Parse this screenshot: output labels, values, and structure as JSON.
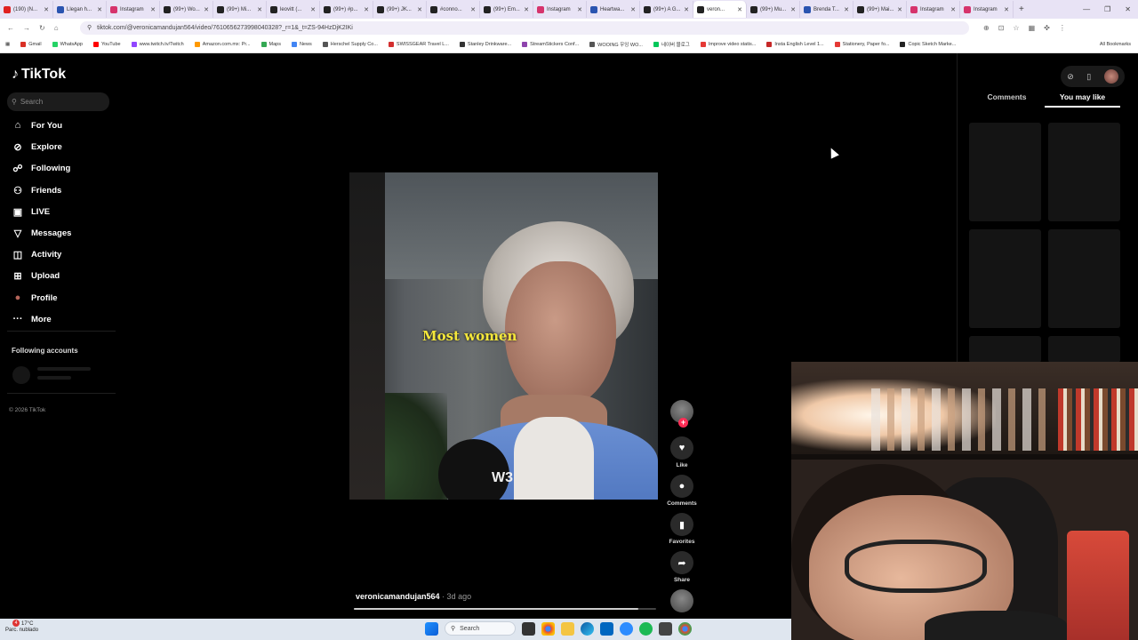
{
  "browser": {
    "tabs": [
      {
        "label": "(190) (N...",
        "color": "#e02020"
      },
      {
        "label": "Llegan h...",
        "color": "#2a54b0"
      },
      {
        "label": "Instagram",
        "color": "#d6336c"
      },
      {
        "label": "(99+) Wo...",
        "color": "#222222"
      },
      {
        "label": "(99+) Mi...",
        "color": "#222222"
      },
      {
        "label": "leovitt (...",
        "color": "#222222"
      },
      {
        "label": "(99+) #p...",
        "color": "#222222"
      },
      {
        "label": "(99+) JK...",
        "color": "#222222"
      },
      {
        "label": "#conno...",
        "color": "#222222"
      },
      {
        "label": "(99+) Em...",
        "color": "#222222"
      },
      {
        "label": "Instagram",
        "color": "#d6336c"
      },
      {
        "label": "Heartwa...",
        "color": "#2a54b0"
      },
      {
        "label": "(99+) A G...",
        "color": "#222222"
      },
      {
        "label": "veron...",
        "color": "#222222",
        "active": true
      },
      {
        "label": "(99+) Mu...",
        "color": "#222222"
      },
      {
        "label": "Brenda T...",
        "color": "#2a54b0"
      },
      {
        "label": "(99+) Mai...",
        "color": "#222222"
      },
      {
        "label": "Instagram",
        "color": "#d6336c"
      },
      {
        "label": "Instagram",
        "color": "#d6336c"
      }
    ],
    "new_tab": "+",
    "window_controls": [
      "—",
      "❐",
      "✕"
    ],
    "url": "tiktok.com/@veronicamandujan564/video/7610656273998040328?_r=1&_t=ZS-94HzDjK2IKi",
    "bookmarks": [
      {
        "label": "Gmail",
        "color": "#d93025"
      },
      {
        "label": "WhatsApp",
        "color": "#25d366"
      },
      {
        "label": "YouTube",
        "color": "#ff0000"
      },
      {
        "label": "www.twitch.tv/Twitch",
        "color": "#9146ff"
      },
      {
        "label": "Amazon.com.mx: Pr...",
        "color": "#ff9900"
      },
      {
        "label": "Maps",
        "color": "#34a853"
      },
      {
        "label": "News",
        "color": "#4285f4"
      },
      {
        "label": "Herschel Supply Co...",
        "color": "#555555"
      },
      {
        "label": "SWISSGEAR Travel L...",
        "color": "#d32f2f"
      },
      {
        "label": "Stanley Drinkware...",
        "color": "#333333"
      },
      {
        "label": "StreamStickers Conf...",
        "color": "#8e44ad"
      },
      {
        "label": "WOOING 우잉 WO...",
        "color": "#555555"
      },
      {
        "label": "네이버 블로그",
        "color": "#03c75a"
      },
      {
        "label": "Improve video statis...",
        "color": "#e53935"
      },
      {
        "label": "Insta English Level 1...",
        "color": "#c62828"
      },
      {
        "label": "Stationery, Paper fo...",
        "color": "#e53935"
      },
      {
        "label": "Copic Sketch Marke...",
        "color": "#222222"
      }
    ],
    "all_bookmarks": "All Bookmarks"
  },
  "sidebar": {
    "logo": "TikTok",
    "search_placeholder": "Search",
    "nav": [
      {
        "label": "For You",
        "icon": "home-icon",
        "glyph": "⌂"
      },
      {
        "label": "Explore",
        "icon": "compass-icon",
        "glyph": "⊘"
      },
      {
        "label": "Following",
        "icon": "following-icon",
        "glyph": "☍"
      },
      {
        "label": "Friends",
        "icon": "friends-icon",
        "glyph": "⚇"
      },
      {
        "label": "LIVE",
        "icon": "live-icon",
        "glyph": "▣"
      },
      {
        "label": "Messages",
        "icon": "messages-icon",
        "glyph": "▽"
      },
      {
        "label": "Activity",
        "icon": "activity-icon",
        "glyph": "◫"
      },
      {
        "label": "Upload",
        "icon": "upload-icon",
        "glyph": "⊞"
      },
      {
        "label": "Profile",
        "icon": "profile-avatar-icon",
        "glyph": "●"
      },
      {
        "label": "More",
        "icon": "more-icon",
        "glyph": "···"
      }
    ],
    "following_accounts": "Following accounts",
    "copyright": "© 2026 TikTok"
  },
  "video": {
    "caption": "Most women",
    "watermark": "W3",
    "author": "veronicamandujan564",
    "posted": "· 3d ago",
    "progress": 0.94
  },
  "actions": {
    "follow_plus": "+",
    "like": "Like",
    "comments": "Comments",
    "favorites": "Favorites",
    "share": "Share"
  },
  "right_panel": {
    "tab_comments": "Comments",
    "tab_you_may_like": "You may like"
  },
  "taskbar": {
    "weather_temp": "17°C",
    "weather_desc": "Parc. nublado",
    "notification_count": "4",
    "search": "Search"
  }
}
